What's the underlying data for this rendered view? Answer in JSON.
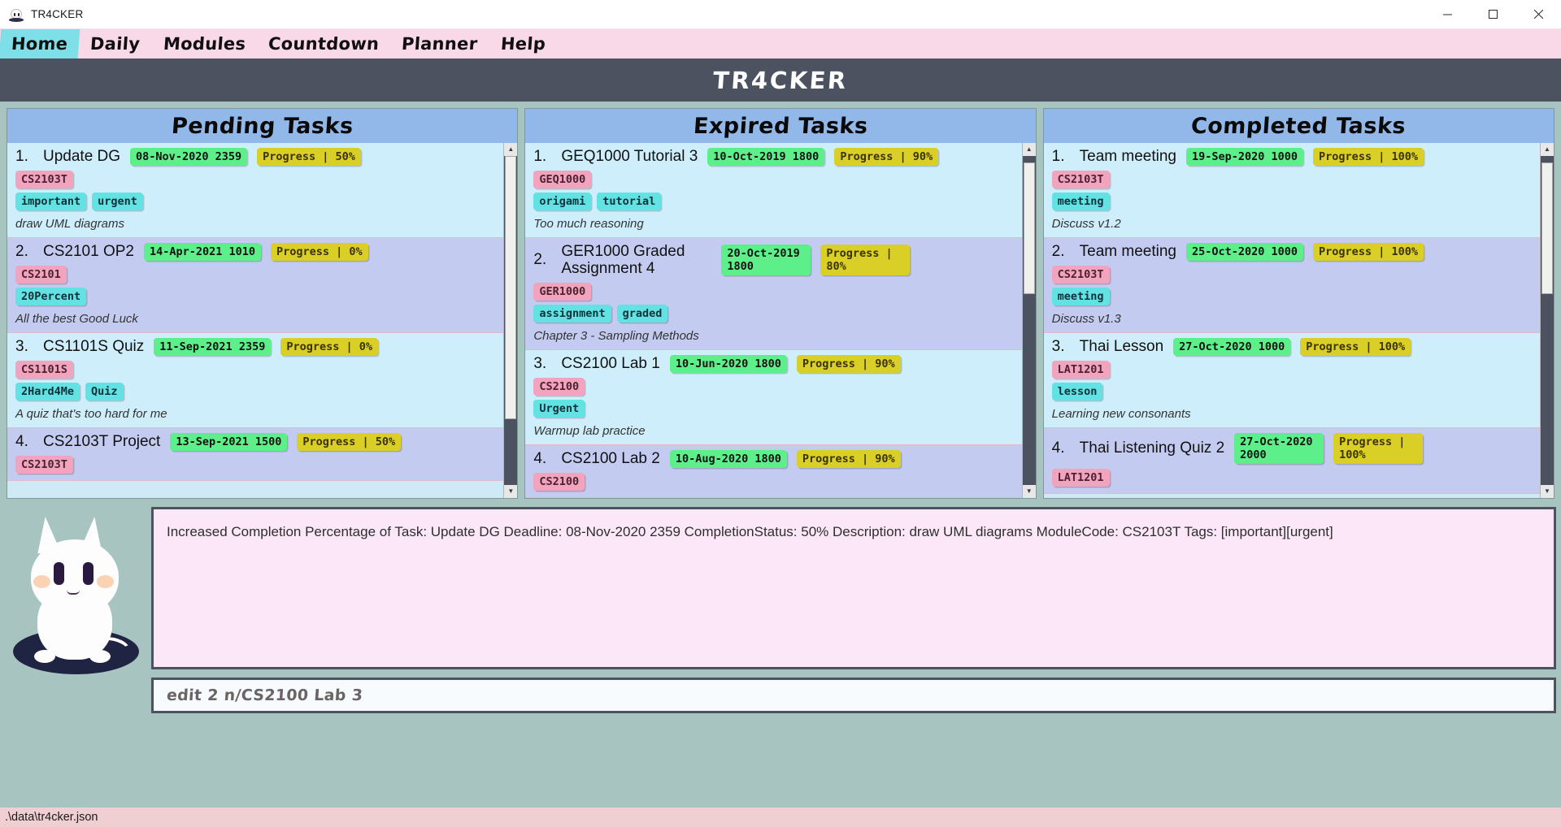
{
  "window": {
    "title": "TR4CKER",
    "icon": "cat-icon",
    "controls": {
      "minimize": "minimize-icon",
      "maximize": "maximize-icon",
      "close": "close-icon"
    }
  },
  "menubar": {
    "items": [
      {
        "label": "Home",
        "active": true
      },
      {
        "label": "Daily",
        "active": false
      },
      {
        "label": "Modules",
        "active": false
      },
      {
        "label": "Countdown",
        "active": false
      },
      {
        "label": "Planner",
        "active": false
      },
      {
        "label": "Help",
        "active": false
      }
    ]
  },
  "banner": {
    "title": "TR4CKER"
  },
  "columns": [
    {
      "title": "Pending Tasks",
      "tasks": [
        {
          "index": "1.",
          "name": "Update DG",
          "deadline": "08-Nov-2020 2359",
          "progress": "Progress | 50%",
          "module": "CS2103T",
          "tags": [
            "important",
            "urgent"
          ],
          "description": "draw UML diagrams"
        },
        {
          "index": "2.",
          "name": "CS2101 OP2",
          "deadline": "14-Apr-2021 1010",
          "progress": "Progress | 0%",
          "module": "CS2101",
          "tags": [
            "20Percent"
          ],
          "description": "All the best Good Luck"
        },
        {
          "index": "3.",
          "name": "CS1101S Quiz",
          "deadline": "11-Sep-2021 2359",
          "progress": "Progress | 0%",
          "module": "CS1101S",
          "tags": [
            "2Hard4Me",
            "Quiz"
          ],
          "description": "A quiz that's too hard for me"
        },
        {
          "index": "4.",
          "name": "CS2103T Project",
          "deadline": "13-Sep-2021 1500",
          "progress": "Progress | 50%",
          "module": "CS2103T",
          "tags": [],
          "description": ""
        }
      ]
    },
    {
      "title": "Expired Tasks",
      "tasks": [
        {
          "index": "1.",
          "name": "GEQ1000 Tutorial 3",
          "deadline": "10-Oct-2019 1800",
          "progress": "Progress | 90%",
          "module": "GEQ1000",
          "tags": [
            "origami",
            "tutorial"
          ],
          "description": "Too much reasoning"
        },
        {
          "index": "2.",
          "name": "GER1000 Graded Assignment 4",
          "deadline": "20-Oct-2019 1800",
          "progress": "Progress | 80%",
          "module": "GER1000",
          "tags": [
            "assignment",
            "graded"
          ],
          "description": "Chapter 3 - Sampling Methods"
        },
        {
          "index": "3.",
          "name": "CS2100 Lab 1",
          "deadline": "10-Jun-2020 1800",
          "progress": "Progress | 90%",
          "module": "CS2100",
          "tags": [
            "Urgent"
          ],
          "description": "Warmup lab practice"
        },
        {
          "index": "4.",
          "name": "CS2100 Lab 2",
          "deadline": "10-Aug-2020 1800",
          "progress": "Progress | 90%",
          "module": "CS2100",
          "tags": [],
          "description": ""
        }
      ]
    },
    {
      "title": "Completed Tasks",
      "tasks": [
        {
          "index": "1.",
          "name": "Team meeting",
          "deadline": "19-Sep-2020 1000",
          "progress": "Progress | 100%",
          "module": "CS2103T",
          "tags": [
            "meeting"
          ],
          "description": "Discuss v1.2"
        },
        {
          "index": "2.",
          "name": "Team meeting",
          "deadline": "25-Oct-2020 1000",
          "progress": "Progress | 100%",
          "module": "CS2103T",
          "tags": [
            "meeting"
          ],
          "description": "Discuss v1.3"
        },
        {
          "index": "3.",
          "name": "Thai Lesson",
          "deadline": "27-Oct-2020 1000",
          "progress": "Progress | 100%",
          "module": "LAT1201",
          "tags": [
            "lesson"
          ],
          "description": "Learning new consonants"
        },
        {
          "index": "4.",
          "name": "Thai Listening Quiz 2",
          "deadline": "27-Oct-2020 2000",
          "progress": "Progress | 100%",
          "module": "LAT1201",
          "tags": [],
          "description": ""
        }
      ]
    }
  ],
  "result": {
    "text": "Increased Completion Percentage of Task: Update DG Deadline: 08-Nov-2020 2359 CompletionStatus: 50% Description: draw UML diagrams ModuleCode: CS2103T Tags: [important][urgent]"
  },
  "command": {
    "value": "edit 2 n/CS2100 Lab 3",
    "placeholder": "Enter command here..."
  },
  "statusbar": {
    "path": ".\\data\\tr4cker.json"
  },
  "colors": {
    "accent_pink": "#f9d8e8",
    "active_tab": "#7fdfe8",
    "banner": "#4c525f",
    "column_header": "#91b8e8",
    "deadline_chip": "#5df08a",
    "progress_chip": "#d9cf27",
    "module_tag": "#f2a3bd",
    "label_tag": "#62e2e2",
    "background": "#a8c4c0",
    "result_bg": "#fce7f8",
    "status_bg": "#efcfd2"
  }
}
